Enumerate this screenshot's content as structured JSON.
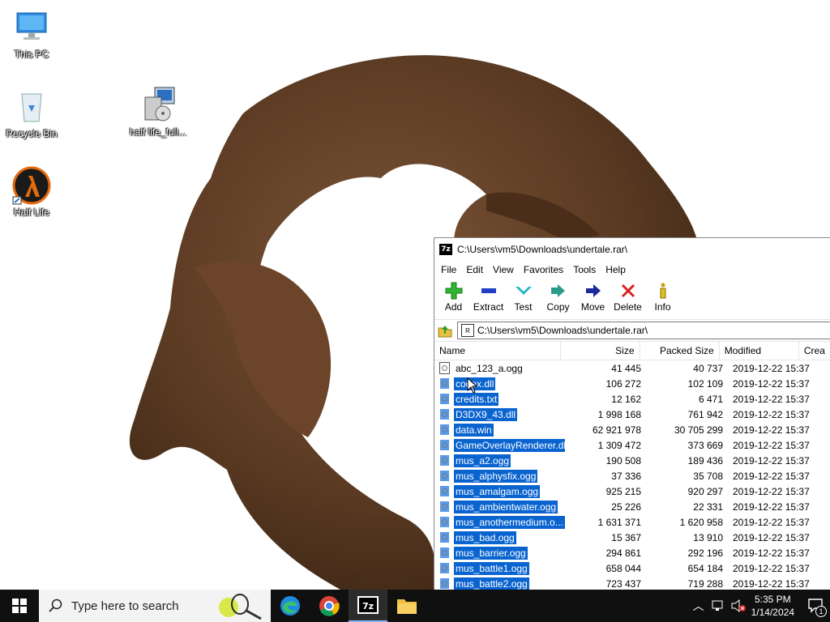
{
  "desktop": {
    "icons": [
      {
        "label": "This PC"
      },
      {
        "label": "Recycle Bin"
      },
      {
        "label": "half life_full..."
      },
      {
        "label": "Half Life"
      }
    ]
  },
  "window": {
    "title": "C:\\Users\\vm5\\Downloads\\undertale.rar\\",
    "menu": [
      "File",
      "Edit",
      "View",
      "Favorites",
      "Tools",
      "Help"
    ],
    "toolbar": [
      "Add",
      "Extract",
      "Test",
      "Copy",
      "Move",
      "Delete",
      "Info"
    ],
    "address": "C:\\Users\\vm5\\Downloads\\undertale.rar\\",
    "columns": [
      "Name",
      "Size",
      "Packed Size",
      "Modified",
      "Crea"
    ],
    "rows": [
      {
        "name": "abc_123_a.ogg",
        "size": "41 445",
        "packed": "40 737",
        "modified": "2019-12-22 15:37",
        "selected": false
      },
      {
        "name": "codex.dll",
        "size": "106 272",
        "packed": "102 109",
        "modified": "2019-12-22 15:37",
        "selected": true
      },
      {
        "name": "credits.txt",
        "size": "12 162",
        "packed": "6 471",
        "modified": "2019-12-22 15:37",
        "selected": true
      },
      {
        "name": "D3DX9_43.dll",
        "size": "1 998 168",
        "packed": "761 942",
        "modified": "2019-12-22 15:37",
        "selected": true
      },
      {
        "name": "data.win",
        "size": "62 921 978",
        "packed": "30 705 299",
        "modified": "2019-12-22 15:37",
        "selected": true
      },
      {
        "name": "GameOverlayRenderer.dll",
        "size": "1 309 472",
        "packed": "373 669",
        "modified": "2019-12-22 15:37",
        "selected": true
      },
      {
        "name": "mus_a2.ogg",
        "size": "190 508",
        "packed": "189 436",
        "modified": "2019-12-22 15:37",
        "selected": true
      },
      {
        "name": "mus_alphysfix.ogg",
        "size": "37 336",
        "packed": "35 708",
        "modified": "2019-12-22 15:37",
        "selected": true
      },
      {
        "name": "mus_amalgam.ogg",
        "size": "925 215",
        "packed": "920 297",
        "modified": "2019-12-22 15:37",
        "selected": true
      },
      {
        "name": "mus_ambientwater.ogg",
        "size": "25 226",
        "packed": "22 331",
        "modified": "2019-12-22 15:37",
        "selected": true
      },
      {
        "name": "mus_anothermedium.o...",
        "size": "1 631 371",
        "packed": "1 620 958",
        "modified": "2019-12-22 15:37",
        "selected": true
      },
      {
        "name": "mus_bad.ogg",
        "size": "15 367",
        "packed": "13 910",
        "modified": "2019-12-22 15:37",
        "selected": true
      },
      {
        "name": "mus_barrier.ogg",
        "size": "294 861",
        "packed": "292 196",
        "modified": "2019-12-22 15:37",
        "selected": true
      },
      {
        "name": "mus_battle1.ogg",
        "size": "658 044",
        "packed": "654 184",
        "modified": "2019-12-22 15:37",
        "selected": true
      },
      {
        "name": "mus_battle2.ogg",
        "size": "723 437",
        "packed": "719 288",
        "modified": "2019-12-22 15:37",
        "selected": true
      }
    ]
  },
  "taskbar": {
    "search_placeholder": "Type here to search",
    "time": "5:35 PM",
    "date": "1/14/2024",
    "notification_count": "1"
  },
  "colors": {
    "selection": "#0a64d0",
    "taskbar": "#101010",
    "wallpaper_object": "#5a3a22"
  }
}
